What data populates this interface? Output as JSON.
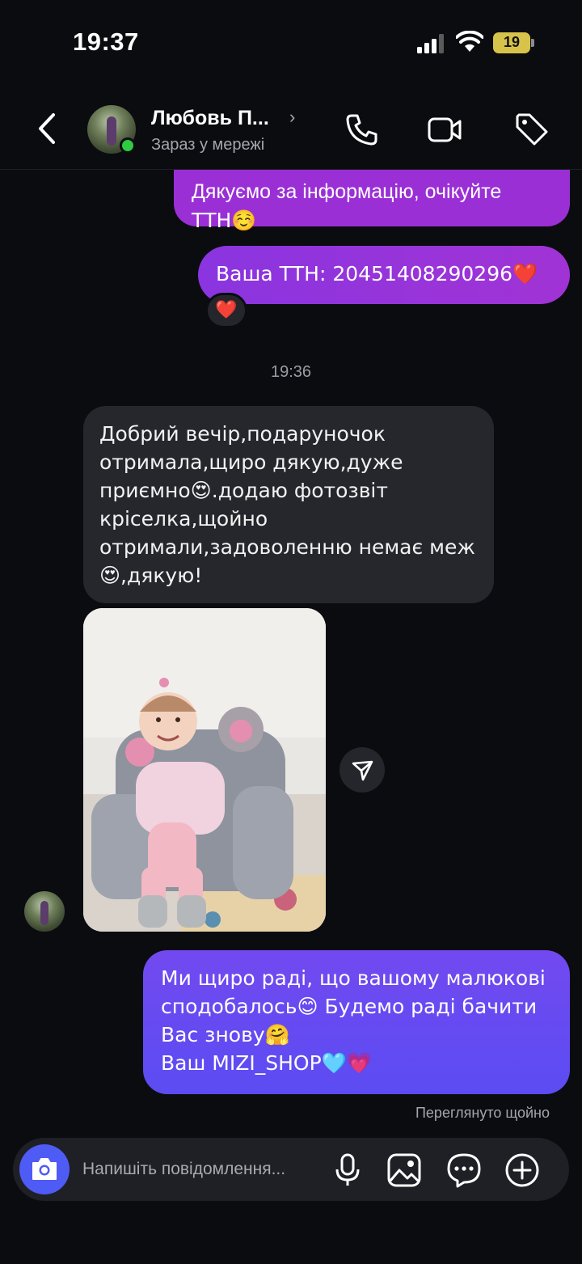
{
  "status_bar": {
    "time": "19:37",
    "battery": "19"
  },
  "header": {
    "contact_name": "Любовь П...",
    "contact_status": "Зараз у мережі",
    "icons": [
      "back-icon",
      "phone-icon",
      "video-icon",
      "tag-icon"
    ]
  },
  "messages": {
    "outgoing_1": {
      "lines": [
        "Дякуємо за інформацію, очікуйте",
        "ТТН☺️"
      ]
    },
    "outgoing_2": {
      "text": "Ваша ТТН: 20451408290296❤️",
      "reaction": "❤️"
    },
    "timestamp": "19:36",
    "incoming_1": {
      "lines": [
        "Добрий вечір,подаруночок",
        "отримала,щиро дякую,дуже",
        "приємно😍.додаю фотозвіт",
        "кріселка,щойно",
        "отримали,задоволенню немає меж",
        "😍,дякую!"
      ]
    },
    "outgoing_3": {
      "lines": [
        "Ми щиро раді, що вашому малюкові",
        "сподобалось😊 Будемо раді бачити",
        "Вас знову🤗",
        "Ваш MIZI_SHOP🩵💗"
      ]
    },
    "seen_label": "Переглянуто щойно"
  },
  "composer": {
    "placeholder": "Напишіть повідомлення...",
    "icons": [
      "camera-icon",
      "microphone-icon",
      "gallery-icon",
      "sticker-icon",
      "plus-icon"
    ]
  },
  "colors": {
    "background": "#0b0c10",
    "outgoing_purple": "#9a2fd6",
    "outgoing_blue": "#5b4cf2",
    "incoming": "#26272d",
    "online": "#2ecc40"
  }
}
